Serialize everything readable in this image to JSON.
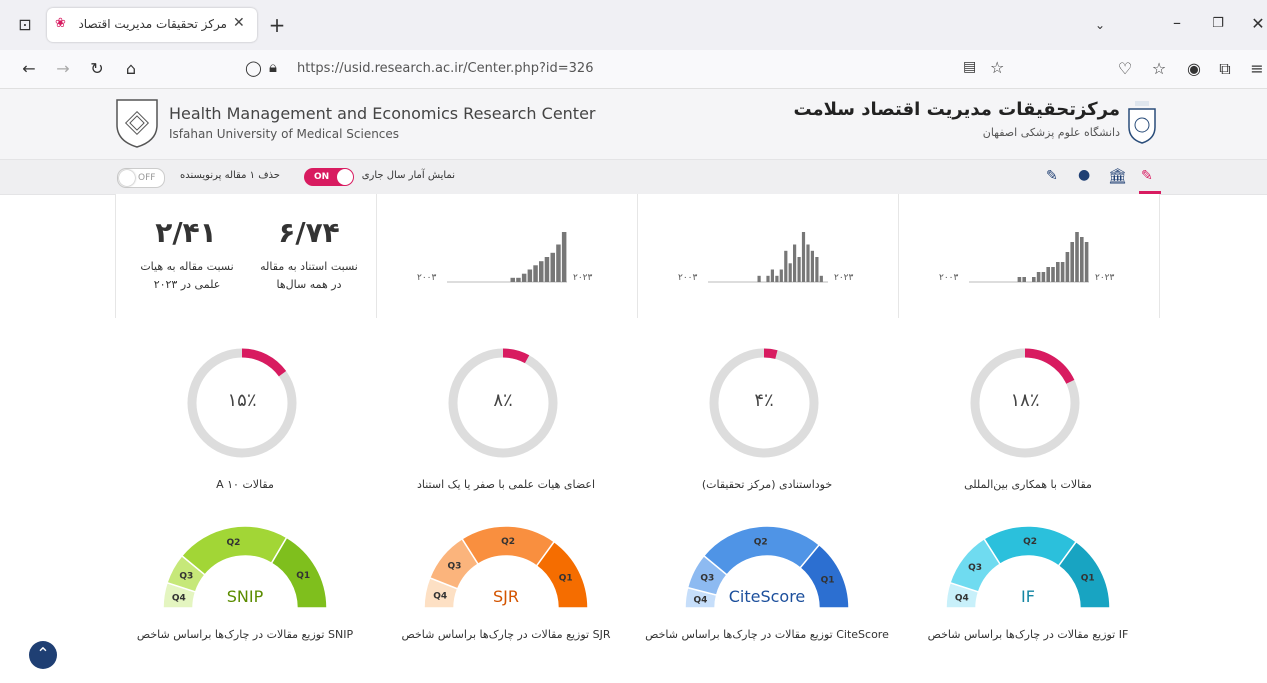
{
  "browser": {
    "tab_title": "مرکز تحقیقات مدیریت اقتصاد سلا",
    "url": "https://usid.research.ac.ir/Center.php?id=326"
  },
  "header": {
    "title_en": "Health Management and Economics Research Center",
    "subtitle_en": "Isfahan University of Medical Sciences",
    "title_fa": "مرکزتحقیقات مدیریت اقتصاد سلامت",
    "subtitle_fa": "دانشگاه علوم پزشکی اصفهان"
  },
  "toolbar": {
    "current_year_label": "نمایش آمار سال جاری",
    "current_year_state": "ON",
    "remove_label": "حذف ۱ مقاله پرنویسنده",
    "remove_state": "OFF"
  },
  "stats": {
    "ratio1_value": "۶/۷۴",
    "ratio1_label_line1": "نسبت استناد به مقاله",
    "ratio1_label_line2": "در همه سال‌ها",
    "ratio2_value": "۲/۴۱",
    "ratio2_label_line1": "نسبت مقاله به هیات",
    "ratio2_label_line2": "علمی در ۲۰۲۳"
  },
  "histograms": [
    {
      "start_label": "۲۰۰۳",
      "end_label": "۲۰۲۳",
      "values": [
        0,
        0,
        0,
        0,
        0,
        0,
        0,
        0,
        0,
        0,
        0,
        1,
        1,
        2,
        3,
        4,
        5,
        6,
        7,
        9,
        12
      ]
    },
    {
      "start_label": "۲۰۰۳",
      "end_label": "۲۰۲۳",
      "values": [
        0,
        0,
        0,
        0,
        0,
        0,
        0,
        0,
        0,
        0,
        0,
        1,
        0,
        1,
        2,
        1,
        2,
        5,
        3,
        6,
        4,
        8,
        6,
        5,
        4,
        1,
        0
      ]
    },
    {
      "start_label": "۲۰۰۳",
      "end_label": "۲۰۲۳",
      "values": [
        0,
        0,
        0,
        0,
        0,
        0,
        0,
        0,
        0,
        0,
        1,
        1,
        0,
        1,
        2,
        2,
        3,
        3,
        4,
        4,
        6,
        8,
        10,
        9,
        8
      ]
    }
  ],
  "donuts": [
    {
      "value": 15,
      "text": "۱۵٪",
      "label": "مقالات ۱۰ A"
    },
    {
      "value": 8,
      "text": "۸٪",
      "label": "اعضای هیات علمی با صفر یا یک استناد"
    },
    {
      "value": 4,
      "text": "۴٪",
      "label": "خوداستنادی (مرکز تحقیقات)"
    },
    {
      "value": 18,
      "text": "۱۸٪",
      "label": "مقالات با همکاری بین‌المللی"
    }
  ],
  "gauges": [
    {
      "name": "SNIP",
      "label": "توزیع مقالات در چارک‌ها براساس شاخص SNIP",
      "colors": [
        "#e4f5c0",
        "#c6e879",
        "#a2d636",
        "#7fbf1d"
      ],
      "text_color": "#5b8c00",
      "q": [
        "Q4",
        "Q3",
        "Q2",
        "Q1"
      ],
      "shares": [
        10,
        12,
        45,
        33
      ]
    },
    {
      "name": "SJR",
      "label": "توزیع مقالات در چارک‌ها براساس شاخص SJR",
      "colors": [
        "#fde0c4",
        "#fbb47c",
        "#f98f3f",
        "#f56d00"
      ],
      "text_color": "#d35400",
      "q": [
        "Q4",
        "Q3",
        "Q2",
        "Q1"
      ],
      "shares": [
        12,
        20,
        38,
        30
      ]
    },
    {
      "name": "CiteScore",
      "label": "توزیع مقالات در چارک‌ها براساس شاخص CiteScore",
      "colors": [
        "#c6defa",
        "#8dbaf1",
        "#4f94e6",
        "#2c6fd1"
      ],
      "text_color": "#1c4f9c",
      "q": [
        "Q4",
        "Q3",
        "Q2",
        "Q1"
      ],
      "shares": [
        8,
        14,
        50,
        28
      ]
    },
    {
      "name": "IF",
      "label": "توزیع مقالات در چارک‌ها براساس شاخص IF",
      "colors": [
        "#c8f0fa",
        "#6fdbf0",
        "#2bc0dc",
        "#18a4c2"
      ],
      "text_color": "#1486a3",
      "q": [
        "Q4",
        "Q3",
        "Q2",
        "Q1"
      ],
      "shares": [
        10,
        22,
        38,
        30
      ]
    }
  ],
  "colors": {
    "accent": "#d81b60",
    "gauge_bg": "#dddddd"
  }
}
